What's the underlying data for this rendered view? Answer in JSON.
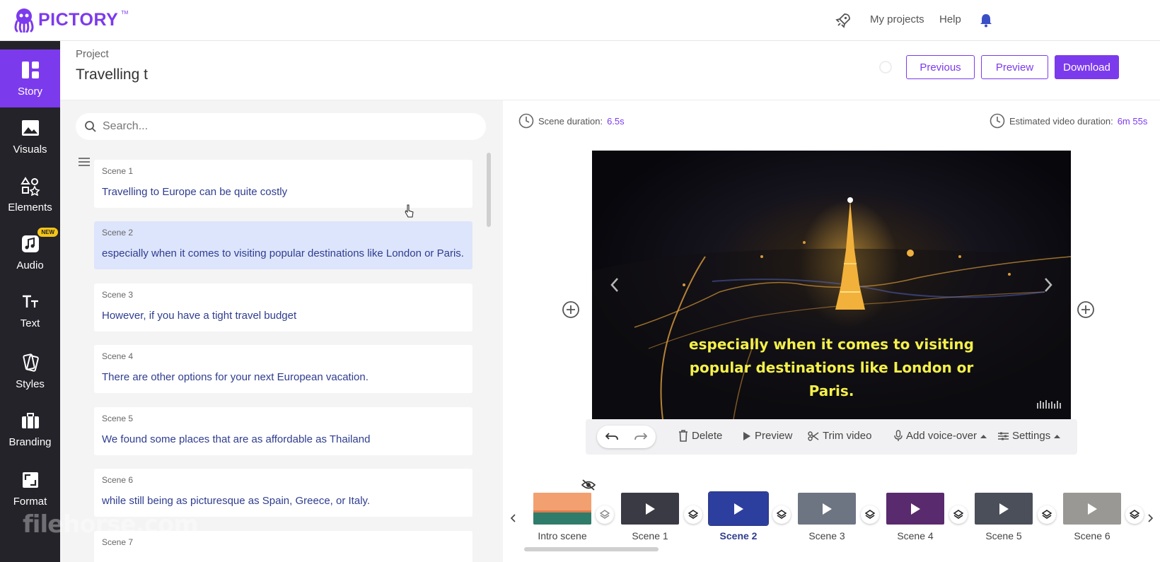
{
  "app": {
    "logo_text": "PICTORY",
    "logo_tm": "TM"
  },
  "topnav": {
    "my_projects": "My projects",
    "help": "Help"
  },
  "sidebar": {
    "items": [
      {
        "label": "Story",
        "icon": "story-icon",
        "active": true
      },
      {
        "label": "Visuals",
        "icon": "image-icon"
      },
      {
        "label": "Elements",
        "icon": "shapes-icon"
      },
      {
        "label": "Audio",
        "icon": "music-icon",
        "badge": "NEW"
      },
      {
        "label": "Text",
        "icon": "text-icon"
      },
      {
        "label": "Styles",
        "icon": "styles-icon"
      },
      {
        "label": "Branding",
        "icon": "briefcase-icon"
      },
      {
        "label": "Format",
        "icon": "format-icon"
      }
    ]
  },
  "project": {
    "label": "Project",
    "title": "Travelling t",
    "buttons": {
      "previous": "Previous",
      "preview": "Preview",
      "download": "Download"
    }
  },
  "search": {
    "placeholder": "Search..."
  },
  "scenes": [
    {
      "num": "Scene 1",
      "text": "Travelling to Europe can be quite costly"
    },
    {
      "num": "Scene 2",
      "text": "especially when it comes to visiting popular destinations like London or Paris.",
      "active": true
    },
    {
      "num": "Scene 3",
      "text": "However, if you have a tight travel budget"
    },
    {
      "num": "Scene 4",
      "text": "There are other options for your next European vacation."
    },
    {
      "num": "Scene 5",
      "text": "We found some places that are as affordable as Thailand"
    },
    {
      "num": "Scene 6",
      "text": "while still being as picturesque as Spain, Greece, or Italy."
    },
    {
      "num": "Scene 7",
      "text": ""
    }
  ],
  "editor": {
    "scene_duration_label": "Scene duration:",
    "scene_duration": "6.5s",
    "estimated_label": "Estimated video duration:",
    "estimated": "6m 55s",
    "caption": "especially when it comes to visiting popular destinations like London or Paris."
  },
  "toolbar": {
    "delete": "Delete",
    "preview": "Preview",
    "trim": "Trim video",
    "voiceover": "Add voice-over",
    "settings": "Settings"
  },
  "timeline": [
    {
      "label": "Intro scene",
      "color": "#e07a4c"
    },
    {
      "label": "Scene 1",
      "color": "#3a3a44"
    },
    {
      "label": "Scene 2",
      "color": "#2c3e9e",
      "selected": true
    },
    {
      "label": "Scene 3",
      "color": "#6d7482"
    },
    {
      "label": "Scene 4",
      "color": "#5a2a6e"
    },
    {
      "label": "Scene 5",
      "color": "#4a4f5a"
    },
    {
      "label": "Scene 6",
      "color": "#9a9894"
    }
  ],
  "watermark": "filehorse.com"
}
